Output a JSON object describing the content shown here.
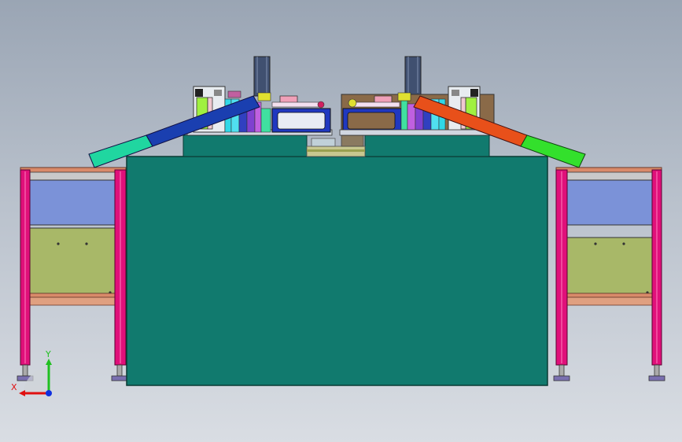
{
  "colors": {
    "machine_body": "#117a6e",
    "frame_leg": "#e0107a",
    "panel_blue": "#7b92d8",
    "panel_olive": "#a8b868",
    "rail_salmon": "#d98a6a",
    "chute_left_blue": "#1a3fb0",
    "chute_left_teal": "#20d6a0",
    "chute_right_orange": "#e8501a",
    "chute_right_green": "#33e02c",
    "axis_x": "#e01010",
    "axis_y": "#20c020",
    "axis_z": "#1030e0"
  },
  "icons": {
    "triad": "xyz-triad-icon"
  },
  "triad": {
    "x_label": "X",
    "y_label": "Y"
  }
}
